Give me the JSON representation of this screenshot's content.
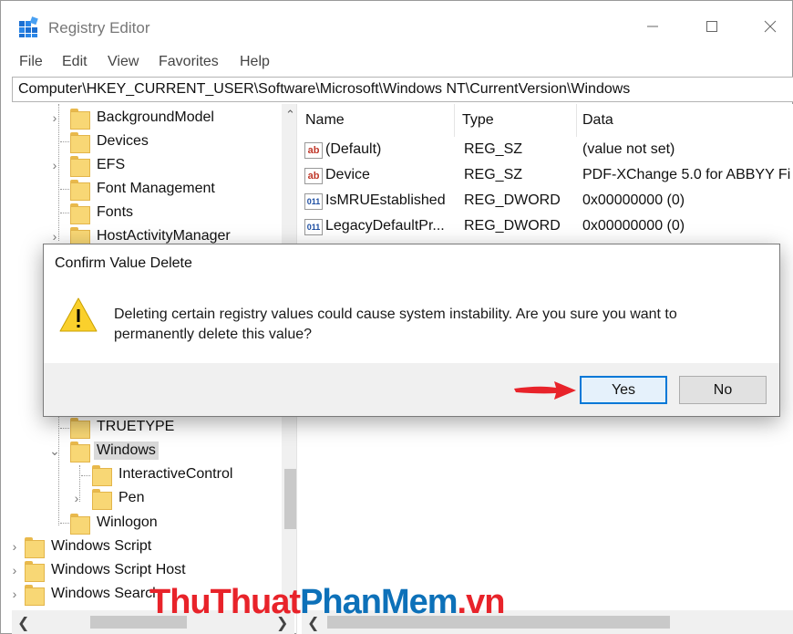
{
  "window": {
    "title": "Registry Editor"
  },
  "menu": [
    "File",
    "Edit",
    "View",
    "Favorites",
    "Help"
  ],
  "address": "Computer\\HKEY_CURRENT_USER\\Software\\Microsoft\\Windows NT\\CurrentVersion\\Windows",
  "tree": {
    "items": [
      {
        "label": "BackgroundModel",
        "expander": "›"
      },
      {
        "label": "Devices",
        "expander": ""
      },
      {
        "label": "EFS",
        "expander": "›"
      },
      {
        "label": "Font Management",
        "expander": ""
      },
      {
        "label": "Fonts",
        "expander": ""
      },
      {
        "label": "HostActivityManager",
        "expander": "›"
      },
      {
        "label": "TRUETYPE",
        "expander": ""
      },
      {
        "label": "Windows",
        "expander": "⌄",
        "selected": true
      },
      {
        "label": "InteractiveControl",
        "expander": ""
      },
      {
        "label": "Pen",
        "expander": "›"
      },
      {
        "label": "Winlogon",
        "expander": ""
      },
      {
        "label": "Windows Script",
        "expander": "›"
      },
      {
        "label": "Windows Script Host",
        "expander": "›"
      },
      {
        "label": "Windows Search",
        "expander": "›"
      }
    ]
  },
  "values": {
    "columns": [
      "Name",
      "Type",
      "Data"
    ],
    "rows": [
      {
        "icon": "ab",
        "name": "(Default)",
        "type": "REG_SZ",
        "data": "(value not set)"
      },
      {
        "icon": "ab",
        "name": "Device",
        "type": "REG_SZ",
        "data": "PDF-XChange 5.0 for ABBYY Fi"
      },
      {
        "icon": "011",
        "name": "IsMRUEstablished",
        "type": "REG_DWORD",
        "data": "0x00000000 (0)"
      },
      {
        "icon": "011",
        "name": "LegacyDefaultPr...",
        "type": "REG_DWORD",
        "data": "0x00000000 (0)"
      }
    ]
  },
  "dialog": {
    "title": "Confirm Value Delete",
    "message": "Deleting certain registry values could cause system instability. Are you sure you want to permanently delete this value?",
    "yes_label": "Yes",
    "no_label": "No"
  },
  "watermark": {
    "part1": "ThuThuat",
    "part2": "PhanMem",
    "part3": ".vn"
  },
  "colors": {
    "accent": "#0078d7",
    "folder": "#f8d775",
    "warning": "#f5c518",
    "arrow": "#e8232a"
  },
  "icons": [
    "regedit-app-icon",
    "minimize-icon",
    "maximize-icon",
    "close-icon",
    "folder-icon",
    "warning-icon",
    "red-arrow-icon"
  ]
}
